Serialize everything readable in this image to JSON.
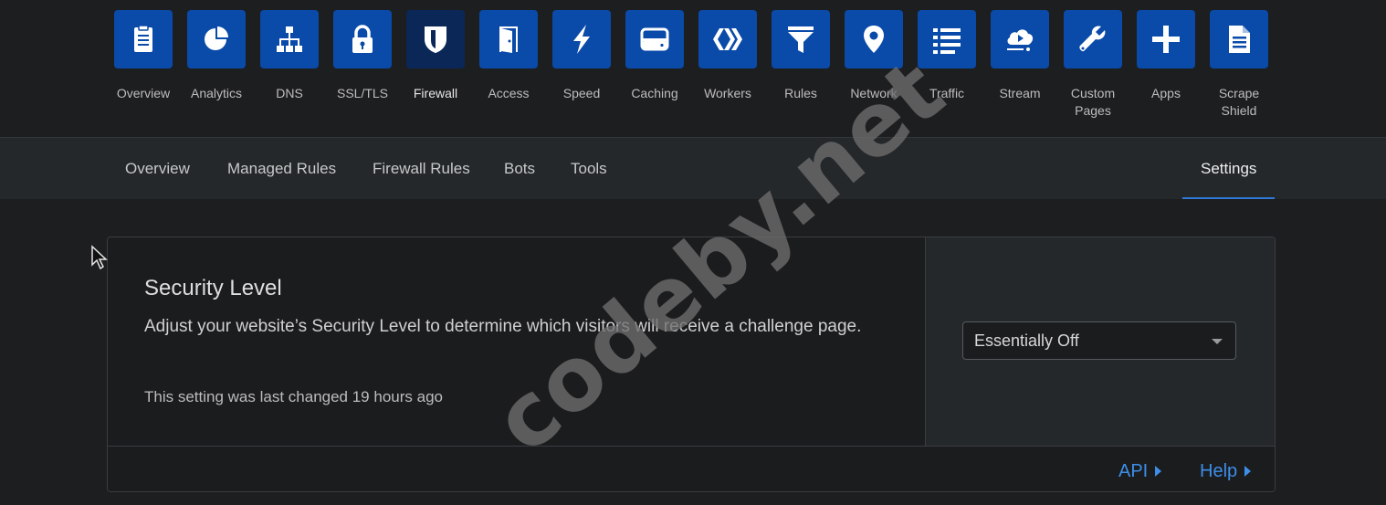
{
  "apps": [
    {
      "label": "Overview",
      "icon": "clipboard-icon"
    },
    {
      "label": "Analytics",
      "icon": "pie-chart-icon"
    },
    {
      "label": "DNS",
      "icon": "network-tree-icon"
    },
    {
      "label": "SSL/TLS",
      "icon": "lock-icon"
    },
    {
      "label": "Firewall",
      "icon": "shield-icon",
      "active": true
    },
    {
      "label": "Access",
      "icon": "door-icon"
    },
    {
      "label": "Speed",
      "icon": "lightning-icon"
    },
    {
      "label": "Caching",
      "icon": "server-drive-icon"
    },
    {
      "label": "Workers",
      "icon": "workers-chevrons-icon"
    },
    {
      "label": "Rules",
      "icon": "filter-funnel-icon"
    },
    {
      "label": "Network",
      "icon": "location-pin-icon"
    },
    {
      "label": "Traffic",
      "icon": "list-icon"
    },
    {
      "label": "Stream",
      "icon": "cloud-stream-icon"
    },
    {
      "label": "Custom\nPages",
      "icon": "wrench-icon"
    },
    {
      "label": "Apps",
      "icon": "plus-icon"
    },
    {
      "label": "Scrape\nShield",
      "icon": "document-icon"
    }
  ],
  "subnav": {
    "tabs": [
      "Overview",
      "Managed Rules",
      "Firewall Rules",
      "Bots",
      "Tools"
    ],
    "active_tab": "Settings"
  },
  "card": {
    "title": "Security Level",
    "description": "Adjust your website’s Security Level to determine which visitors will receive a challenge page.",
    "meta": "This setting was last changed 19 hours ago",
    "select_value": "Essentially Off",
    "footer_api": "API",
    "footer_help": "Help"
  },
  "watermark": "codeby.net",
  "colors": {
    "tile": "#0a4aa8",
    "tile_active": "#0b2757",
    "link": "#3d8ee8",
    "tab_underline": "#2f7ad9"
  }
}
